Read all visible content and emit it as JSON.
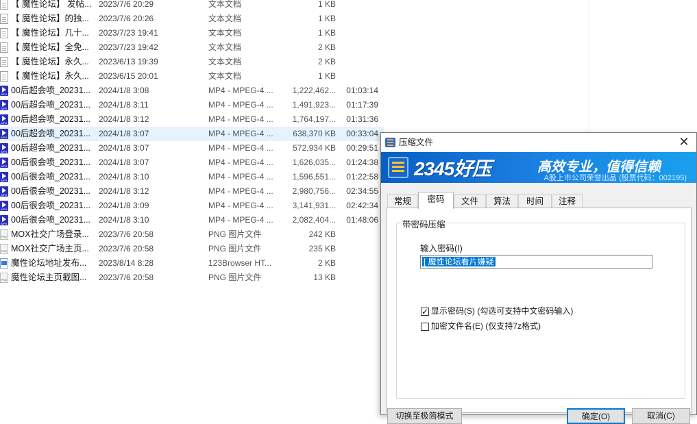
{
  "files": [
    {
      "icon": "text-file-icon",
      "name": "【 魔性论坛】 发帖...",
      "date": "2023/7/6 20:29",
      "type": "文本文档",
      "size": "1 KB",
      "duration": ""
    },
    {
      "icon": "text-file-icon",
      "name": "【 魔性论坛】的独...",
      "date": "2023/7/6 20:26",
      "type": "文本文档",
      "size": "1 KB",
      "duration": ""
    },
    {
      "icon": "text-file-icon",
      "name": "【 魔性论坛】几十...",
      "date": "2023/7/23 19:41",
      "type": "文本文档",
      "size": "1 KB",
      "duration": ""
    },
    {
      "icon": "text-file-icon",
      "name": "【 魔性论坛】全免...",
      "date": "2023/7/23 19:42",
      "type": "文本文档",
      "size": "2 KB",
      "duration": ""
    },
    {
      "icon": "text-file-icon",
      "name": "【 魔性论坛】永久...",
      "date": "2023/6/13 19:39",
      "type": "文本文档",
      "size": "2 KB",
      "duration": ""
    },
    {
      "icon": "text-file-icon",
      "name": "【 魔性论坛】永久...",
      "date": "2023/6/15 20:01",
      "type": "文本文档",
      "size": "1 KB",
      "duration": ""
    },
    {
      "icon": "mp4-file-icon",
      "name": "00后超会喷_20231...",
      "date": "2024/1/8 3:08",
      "type": "MP4 - MPEG-4 ...",
      "size": "1,222,462...",
      "duration": "01:03:14"
    },
    {
      "icon": "mp4-file-icon",
      "name": "00后超会喷_20231...",
      "date": "2024/1/8 3:11",
      "type": "MP4 - MPEG-4 ...",
      "size": "1,491,923...",
      "duration": "01:17:39"
    },
    {
      "icon": "mp4-file-icon",
      "name": "00后超会喷_20231...",
      "date": "2024/1/8 3:12",
      "type": "MP4 - MPEG-4 ...",
      "size": "1,764,197...",
      "duration": "01:31:36"
    },
    {
      "icon": "mp4-file-icon",
      "name": "00后超会喷_20231...",
      "date": "2024/1/8 3:07",
      "type": "MP4 - MPEG-4 ...",
      "size": "638,370 KB",
      "duration": "00:33:04",
      "highlight": true
    },
    {
      "icon": "mp4-file-icon",
      "name": "00后超会喷_20231...",
      "date": "2024/1/8 3:07",
      "type": "MP4 - MPEG-4 ...",
      "size": "572,934 KB",
      "duration": "00:29:51"
    },
    {
      "icon": "mp4-file-icon",
      "name": "00后很会喷_20231...",
      "date": "2024/1/8 3:07",
      "type": "MP4 - MPEG-4 ...",
      "size": "1,626,035...",
      "duration": "01:24:38"
    },
    {
      "icon": "mp4-file-icon",
      "name": "00后很会喷_20231...",
      "date": "2024/1/8 3:10",
      "type": "MP4 - MPEG-4 ...",
      "size": "1,596,551...",
      "duration": "01:22:58"
    },
    {
      "icon": "mp4-file-icon",
      "name": "00后很会喷_20231...",
      "date": "2024/1/8 3:12",
      "type": "MP4 - MPEG-4 ...",
      "size": "2,980,756...",
      "duration": "02:34:55"
    },
    {
      "icon": "mp4-file-icon",
      "name": "00后很会喷_20231...",
      "date": "2024/1/8 3:09",
      "type": "MP4 - MPEG-4 ...",
      "size": "3,141,931...",
      "duration": "02:42:34"
    },
    {
      "icon": "mp4-file-icon",
      "name": "00后很会喷_20231...",
      "date": "2024/1/8 3:10",
      "type": "MP4 - MPEG-4 ...",
      "size": "2,082,404...",
      "duration": "01:48:06"
    },
    {
      "icon": "png-file-icon",
      "name": "MOX社交广场登录...",
      "date": "2023/7/6 20:58",
      "type": "PNG 图片文件",
      "size": "242 KB",
      "duration": ""
    },
    {
      "icon": "png-file-icon",
      "name": "MOX社交广场主页...",
      "date": "2023/7/6 20:58",
      "type": "PNG 图片文件",
      "size": "235 KB",
      "duration": ""
    },
    {
      "icon": "html-file-icon",
      "name": "魔性论坛地址发布...",
      "date": "2023/8/14 8:28",
      "type": "123Browser HT...",
      "size": "2 KB",
      "duration": ""
    },
    {
      "icon": "png-file-icon",
      "name": "魔性论坛主页截图...",
      "date": "2023/7/6 20:58",
      "type": "PNG 图片文件",
      "size": "13 KB",
      "duration": ""
    }
  ],
  "dialog": {
    "title": "压缩文件",
    "close_label": "✕",
    "banner": {
      "brand": "2345好压",
      "slogan": "高效专业，值得信赖",
      "subtitle": "A股上市公司荣誉出品 (股票代码：002195)"
    },
    "tabs": [
      {
        "label": "常规",
        "active": false
      },
      {
        "label": "密码",
        "active": true
      },
      {
        "label": "文件",
        "active": false
      },
      {
        "label": "算法",
        "active": false
      },
      {
        "label": "时间",
        "active": false
      },
      {
        "label": "注释",
        "active": false
      }
    ],
    "group_title": "带密码压缩",
    "password_label": "输入密码(I)",
    "password_value": "[ 魔性论坛看片嫌疑",
    "show_password": {
      "label": "显示密码(S)  (勾选可支持中文密码输入)",
      "checked": true
    },
    "encrypt_names": {
      "label": "加密文件名(E)  (仅支持7z格式)",
      "checked": false
    },
    "buttons": {
      "switch_mode": "切换至极简模式",
      "ok": "确定(O)",
      "cancel": "取消(C)"
    }
  },
  "colors": {
    "banner_start": "#0a5ec2",
    "banner_end": "#1aa0ee",
    "selection": "#0078d7",
    "row_highlight": "#e5f3ff"
  }
}
